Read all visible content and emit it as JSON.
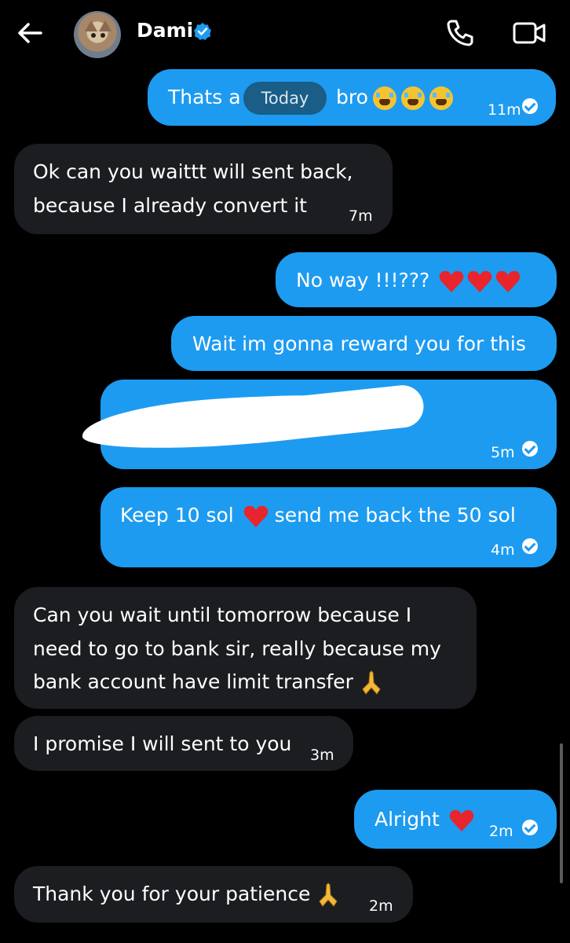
{
  "header": {
    "contact_name": "Dami",
    "icons": {
      "back": "arrow-left-icon",
      "verified": "verified-badge-icon",
      "call": "phone-icon",
      "video": "video-icon"
    },
    "accent_color": "#1d9bf0"
  },
  "date_separator": "Today",
  "messages": [
    {
      "id": "m1",
      "direction": "sent",
      "text_start": "Thats a",
      "text_end": "bro",
      "time": "11m"
    },
    {
      "id": "m2",
      "direction": "received",
      "lines": [
        "Ok can you waittt will sent back,",
        "because I already convert it"
      ],
      "time": "7m"
    },
    {
      "id": "m3",
      "direction": "sent",
      "text": "No way !!!???"
    },
    {
      "id": "m4",
      "direction": "sent",
      "text": "Wait im gonna reward you for this"
    },
    {
      "id": "m5",
      "direction": "sent",
      "text": "",
      "time": "5m"
    },
    {
      "id": "m6",
      "direction": "sent",
      "text_start": "Keep 10 sol",
      "text_end": "send me back the 50 sol",
      "time": "4m"
    },
    {
      "id": "m7",
      "direction": "received",
      "lines": [
        "Can you wait until tomorrow because I",
        "need to go to bank sir, really because my",
        "bank account have limit transfer"
      ]
    },
    {
      "id": "m8",
      "direction": "received",
      "text": "I promise I will sent to you",
      "time": "3m"
    },
    {
      "id": "m9",
      "direction": "sent",
      "text": "Alright",
      "time": "2m"
    },
    {
      "id": "m10",
      "direction": "received",
      "text": "Thank you for your patience",
      "time": "2m"
    }
  ],
  "colors": {
    "sent_bubble": "#1d9bf0",
    "received_bubble": "#1b1d21",
    "background": "#000000"
  }
}
